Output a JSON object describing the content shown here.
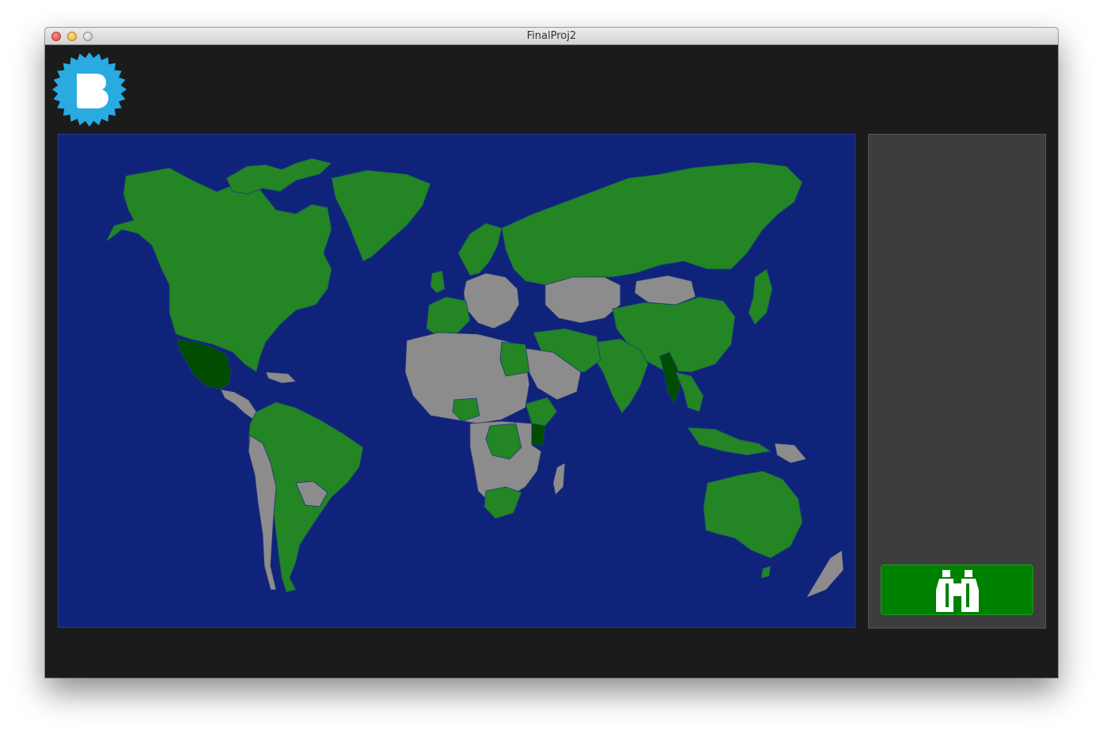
{
  "window": {
    "title": "FinalProj2"
  },
  "colors": {
    "map_background": "#10237a",
    "visited_country": "#238523",
    "highlighted_country": "#004d00",
    "unvisited_country": "#8c8c8c",
    "side_panel": "#3d3d3d",
    "search_button": "#008000",
    "logo": "#29aae1"
  },
  "icons": {
    "logo": "badge-b-logo",
    "search_button": "binoculars-icon"
  },
  "logo": {
    "letter": "B"
  }
}
